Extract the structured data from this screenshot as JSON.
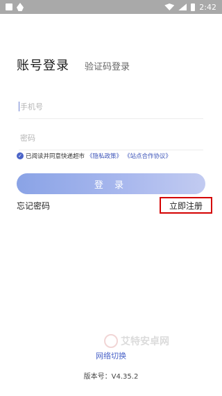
{
  "statusbar": {
    "time": "2:42"
  },
  "tabs": {
    "active": "账号登录",
    "inactive": "验证码登录"
  },
  "phone": {
    "placeholder": "手机号",
    "value": ""
  },
  "password": {
    "placeholder": "密码",
    "value": ""
  },
  "agreement": {
    "prefix": "已阅读并同意快递超市",
    "privacy": "《隐私政策》",
    "site": "《站点合作协议》",
    "checked": true
  },
  "login_button": "登 录",
  "forgot_password": "忘记密码",
  "register": "立即注册",
  "network_switch": "网络切换",
  "version": "版本号：V4.35.2",
  "watermark": "艾特安卓网",
  "colors": {
    "accent": "#4a63c8",
    "register_border": "#d40000",
    "button_start": "#8aa3e6"
  }
}
